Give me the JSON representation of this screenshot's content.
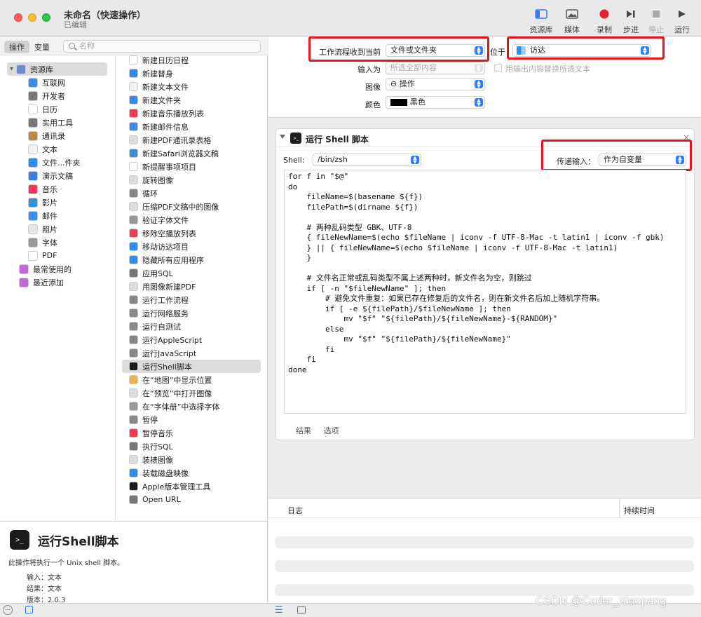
{
  "window": {
    "title": "未命名（快速操作）",
    "subtitle": "已编辑"
  },
  "toolbar": [
    {
      "label": "资源库",
      "icon": "library-icon",
      "dim": false
    },
    {
      "label": "媒体",
      "icon": "media-icon",
      "dim": false
    },
    {
      "label": "录制",
      "icon": "record-icon",
      "dim": false
    },
    {
      "label": "步进",
      "icon": "step-icon",
      "dim": false
    },
    {
      "label": "停止",
      "icon": "stop-icon",
      "dim": true
    },
    {
      "label": "运行",
      "icon": "run-icon",
      "dim": false
    }
  ],
  "library": {
    "tabs": [
      "操作",
      "变量"
    ],
    "search_placeholder": "名称",
    "categories": [
      {
        "label": "资源库",
        "color": "#6f8bd3"
      },
      {
        "label": "互联网",
        "color": "#3b8de0"
      },
      {
        "label": "开发者",
        "color": "#777777"
      },
      {
        "label": "日历",
        "color": "#ffffff"
      },
      {
        "label": "实用工具",
        "color": "#777777"
      },
      {
        "label": "通讯录",
        "color": "#b68a4c"
      },
      {
        "label": "文本",
        "color": "#f2f2f2"
      },
      {
        "label": "文件...件夹",
        "color": "#2f8cf0"
      },
      {
        "label": "演示文稿",
        "color": "#3b7de0"
      },
      {
        "label": "音乐",
        "color": "#f13b55"
      },
      {
        "label": "影片",
        "color": "#3a8fd9"
      },
      {
        "label": "邮件",
        "color": "#3a8ef0"
      },
      {
        "label": "照片",
        "color": "#e6e6e6"
      },
      {
        "label": "字体",
        "color": "#999999"
      },
      {
        "label": "PDF",
        "color": "#ffffff"
      },
      {
        "label": "最常使用的",
        "color": "#c06ad8"
      },
      {
        "label": "最近添加",
        "color": "#c06ad8"
      }
    ],
    "actions": [
      {
        "label": "新建日历",
        "color": "#ffffff"
      },
      {
        "label": "新建日历日程",
        "color": "#ffffff"
      },
      {
        "label": "新建替身",
        "color": "#2f8cf0"
      },
      {
        "label": "新建文本文件",
        "color": "#f2f2f2"
      },
      {
        "label": "新建文件夹",
        "color": "#2f8cf0"
      },
      {
        "label": "新建音乐播放列表",
        "color": "#f13b55"
      },
      {
        "label": "新建邮件信息",
        "color": "#3a8ef0"
      },
      {
        "label": "新建PDF通讯录表格",
        "color": "#dddddd"
      },
      {
        "label": "新建Safari浏览器文稿",
        "color": "#3a8fd9"
      },
      {
        "label": "新提醒事项项目",
        "color": "#ffffff"
      },
      {
        "label": "旋转图像",
        "color": "#dddddd"
      },
      {
        "label": "循环",
        "color": "#888888"
      },
      {
        "label": "压缩PDF文稿中的图像",
        "color": "#dddddd"
      },
      {
        "label": "验证字体文件",
        "color": "#999999"
      },
      {
        "label": "移除空播放列表",
        "color": "#f13b55"
      },
      {
        "label": "移动访达项目",
        "color": "#2f8cf0"
      },
      {
        "label": "隐藏所有应用程序",
        "color": "#2f8cf0"
      },
      {
        "label": "应用SQL",
        "color": "#777777"
      },
      {
        "label": "用图像新建PDF",
        "color": "#dddddd"
      },
      {
        "label": "运行工作流程",
        "color": "#888888"
      },
      {
        "label": "运行网络服务",
        "color": "#888888"
      },
      {
        "label": "运行自测试",
        "color": "#888888"
      },
      {
        "label": "运行AppleScript",
        "color": "#888888"
      },
      {
        "label": "运行JavaScript",
        "color": "#888888"
      },
      {
        "label": "运行Shell脚本",
        "color": "#1c1c1c"
      },
      {
        "label": "在“地图”中显示位置",
        "color": "#e8b94a"
      },
      {
        "label": "在“预览”中打开图像",
        "color": "#dddddd"
      },
      {
        "label": "在“字体册”中选择字体",
        "color": "#999999"
      },
      {
        "label": "暂停",
        "color": "#888888"
      },
      {
        "label": "暂停音乐",
        "color": "#f13b55"
      },
      {
        "label": "执行SQL",
        "color": "#777777"
      },
      {
        "label": "装裱图像",
        "color": "#dddddd"
      },
      {
        "label": "装载磁盘映像",
        "color": "#2f8cf0"
      },
      {
        "label": "Apple版本管理工具",
        "color": "#1c1c1c"
      },
      {
        "label": "Open URL",
        "color": "#777777"
      }
    ]
  },
  "description": {
    "icon_text": ">_",
    "title": "运行Shell脚本",
    "text": "此操作将执行一个 Unix shell 脚本。",
    "details": [
      {
        "k": "输入：",
        "v": "文本"
      },
      {
        "k": "结果：",
        "v": "文本"
      },
      {
        "k": "版本：",
        "v": "2.0.3"
      }
    ]
  },
  "workflow": {
    "receives_label": "工作流程收到当前",
    "receives_value": "文件或文件夹",
    "in_label": "位于",
    "in_value": "访达",
    "input_label": "输入为",
    "input_value": "所选全部内容",
    "replace_label": "用输出内容替换所选文本",
    "image_label": "图像",
    "image_value": "⊖ 操作",
    "color_label": "颜色",
    "color_value": "黑色"
  },
  "action_card": {
    "title": "运行 Shell 脚本",
    "shell_label": "Shell:",
    "shell_value": "/bin/zsh",
    "pass_label": "传递输入：",
    "pass_value": "作为自变量",
    "script": "for f in \"$@\"\ndo\n    fileName=$(basename ${f})\n    filePath=$(dirname ${f})\n\n    # 两种乱码类型 GBK、UTF-8\n    { fileNewName=$(echo $fileName | iconv -f UTF-8-Mac -t latin1 | iconv -f gbk)\n    } || { fileNewName=$(echo $fileName | iconv -f UTF-8-Mac -t latin1)\n    }\n\n    # 文件名正常或乱码类型不属上述两种时，新文件名为空，则跳过\n    if [ -n \"$fileNewName\" ]; then\n        # 避免文件重复：如果已存在修复后的文件名，则在新文件名后加上随机字符串。\n        if [ -e ${filePath}/$fileNewName ]; then\n            mv \"$f\" \"${filePath}/${fileNewName}-${RANDOM}\"\n        else\n            mv \"$f\" \"${filePath}/${fileNewName}\"\n        fi\n    fi\ndone",
    "tab_results": "结果",
    "tab_options": "选项"
  },
  "log": {
    "col_log": "日志",
    "col_duration": "持续时间"
  },
  "watermark": "CSDN @Coder_Xiaopang"
}
